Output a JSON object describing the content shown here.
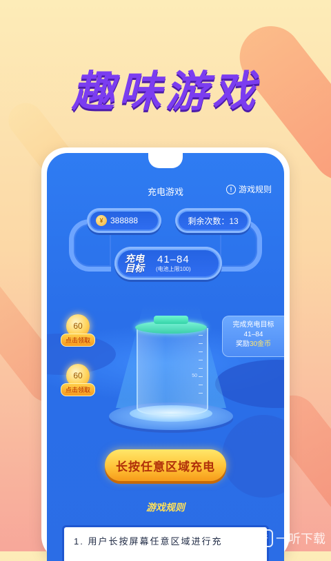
{
  "headline": "趣味游戏",
  "screen": {
    "title": "充电游戏",
    "rules_link": "游戏规则",
    "coins": "388888",
    "coin_symbol": "¥",
    "remaining": "剩余次数：13",
    "target_label": "充电目标",
    "target_range": "41–84",
    "target_note": "(电池上限100)",
    "battery_scale_label": "50",
    "bubbles": [
      {
        "value": "60",
        "action": "点击领取"
      },
      {
        "value": "60",
        "action": "点击领取"
      }
    ],
    "goal_card": {
      "line1": "完成充电目标",
      "line2": "41–84",
      "line3_prefix": "奖励",
      "line3_amount": "30金币"
    },
    "charge_button": "长按任意区域充电",
    "rules_title": "游戏规则",
    "rules_text": "1. 用户长按屏幕任意区域进行充"
  },
  "watermark": {
    "icon": "听",
    "text": "一听下载"
  },
  "colors": {
    "headline": "#7b3df0",
    "screen_bg": "#2f7cf2",
    "button": "#ffc338",
    "battery_cap": "#35d3a8"
  }
}
